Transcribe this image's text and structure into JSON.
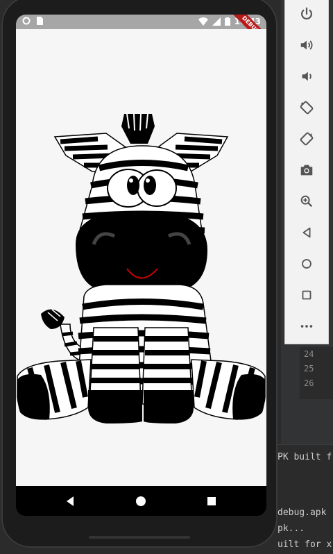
{
  "ide": {
    "line_numbers": [
      "24",
      "25",
      "26"
    ],
    "console_lines": [
      "PK built f",
      "debug.apk",
      "pk...",
      "uilt for x"
    ]
  },
  "status_bar": {
    "time": "10:43"
  },
  "debug_banner": "DEBUG",
  "toolbar": {
    "items": [
      "power-icon",
      "volume-up-icon",
      "volume-down-icon",
      "rotate-left-icon",
      "rotate-right-icon",
      "camera-icon",
      "zoom-icon",
      "back-icon",
      "home-icon",
      "overview-icon",
      "more-icon"
    ]
  },
  "colors": {
    "zebra_black": "#000000",
    "smile": "#cc0000",
    "app_background": "#f6f6f6",
    "status_bar": "#a6a6a6",
    "toolbar": "#f2f2f2"
  }
}
